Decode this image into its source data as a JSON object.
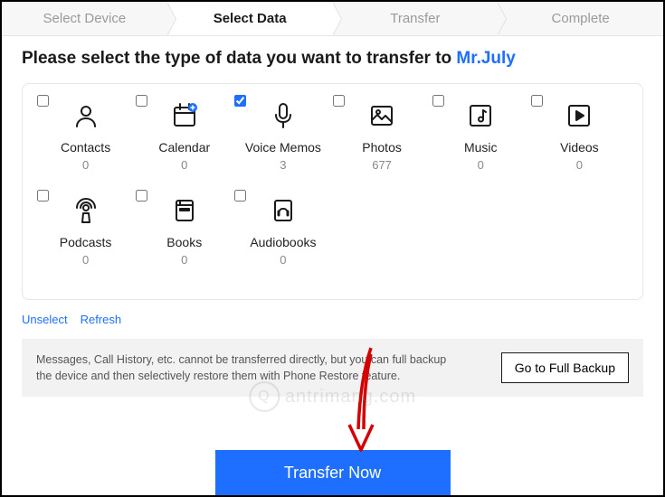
{
  "steps": [
    {
      "label": "Select Device",
      "active": false
    },
    {
      "label": "Select Data",
      "active": true
    },
    {
      "label": "Transfer",
      "active": false
    },
    {
      "label": "Complete",
      "active": false
    }
  ],
  "prompt_prefix": "Please select the type of data you want to transfer to ",
  "target_device": "Mr.July",
  "items": [
    {
      "name": "Contacts",
      "count": "0",
      "checked": false,
      "icon": "contacts"
    },
    {
      "name": "Calendar",
      "count": "0",
      "checked": false,
      "icon": "calendar"
    },
    {
      "name": "Voice Memos",
      "count": "3",
      "checked": true,
      "icon": "voice"
    },
    {
      "name": "Photos",
      "count": "677",
      "checked": false,
      "icon": "photos"
    },
    {
      "name": "Music",
      "count": "0",
      "checked": false,
      "icon": "music"
    },
    {
      "name": "Videos",
      "count": "0",
      "checked": false,
      "icon": "videos"
    },
    {
      "name": "Podcasts",
      "count": "0",
      "checked": false,
      "icon": "podcasts"
    },
    {
      "name": "Books",
      "count": "0",
      "checked": false,
      "icon": "books"
    },
    {
      "name": "Audiobooks",
      "count": "0",
      "checked": false,
      "icon": "audiobooks"
    }
  ],
  "links": {
    "unselect": "Unselect",
    "refresh": "Refresh"
  },
  "notice_text": "Messages, Call History, etc. cannot be transferred directly, but you can full backup the device and then selectively restore them with Phone Restore feature.",
  "full_backup_label": "Go to Full Backup",
  "transfer_label": "Transfer Now",
  "watermark": "antrimang.com",
  "colors": {
    "accent": "#1e6fff"
  }
}
